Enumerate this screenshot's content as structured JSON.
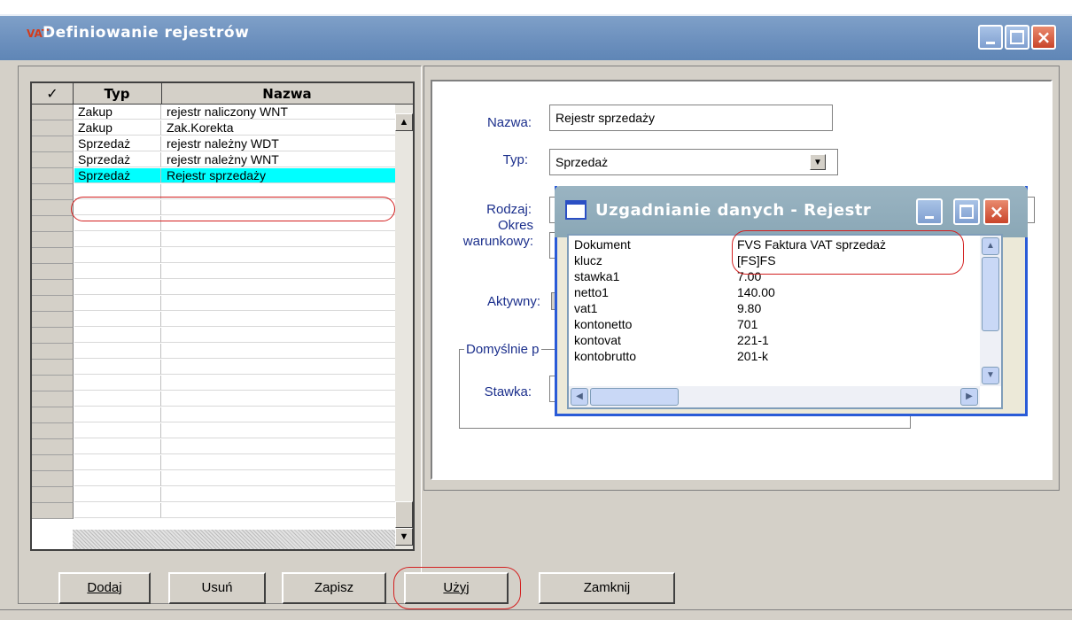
{
  "window": {
    "title": "Definiowanie rejestrów",
    "icon_text": "VAT"
  },
  "grid": {
    "headers": {
      "check_icon": "check-icon",
      "typ": "Typ",
      "nazwa": "Nazwa"
    },
    "rows": [
      {
        "typ": "Zakup",
        "nazwa": "rejestr naliczony WNT"
      },
      {
        "typ": "Zakup",
        "nazwa": "Zak.Korekta"
      },
      {
        "typ": "Sprzedaż",
        "nazwa": "rejestr należny WDT"
      },
      {
        "typ": "Sprzedaż",
        "nazwa": "rejestr należny WNT"
      },
      {
        "typ": "Sprzedaż",
        "nazwa": "Rejestr sprzedaży"
      }
    ],
    "selected_index": 4
  },
  "form": {
    "nazwa_label": "Nazwa:",
    "nazwa_value": "Rejestr sprzedaży",
    "typ_label": "Typ:",
    "typ_value": "Sprzedaż",
    "rodzaj_label": "Rodzaj:",
    "okres_label_1": "Okres",
    "okres_label_2": "warunkowy:",
    "aktywny_label": "Aktywny:",
    "group_label": "Domyślnie p",
    "stawka_label": "Stawka:"
  },
  "popup": {
    "title": "Uzgadnianie danych - Rejestr",
    "rows": [
      {
        "key": "Dokument",
        "value": "FVS  Faktura VAT sprzedaż"
      },
      {
        "key": "klucz",
        "value": "[FS]FS"
      },
      {
        "key": "stawka1",
        "value": "7.00"
      },
      {
        "key": "netto1",
        "value": "140.00"
      },
      {
        "key": "vat1",
        "value": "9.80"
      },
      {
        "key": "kontonetto",
        "value": "701"
      },
      {
        "key": "kontovat",
        "value": "221-1"
      },
      {
        "key": "kontobrutto",
        "value": "201-k"
      }
    ]
  },
  "buttons": {
    "dodaj": "Dodaj",
    "usun": "Usuń",
    "zapisz": "Zapisz",
    "uzyj": "Użyj",
    "zamknij": "Zamknij"
  },
  "colors": {
    "selection": "#00ffff",
    "annotation": "#d32020",
    "label": "#1b2f8c"
  }
}
